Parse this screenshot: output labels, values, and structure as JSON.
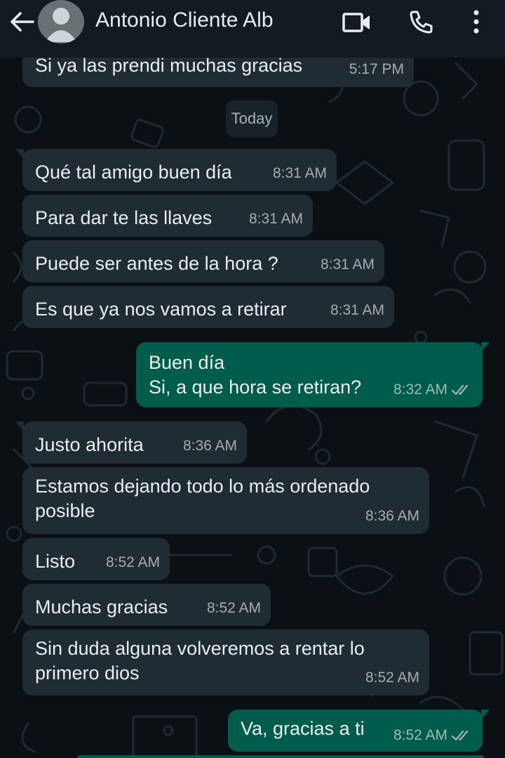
{
  "header": {
    "contact_name": "Antonio Cliente Alb",
    "icons": [
      "back-arrow-icon",
      "avatar",
      "video-call-icon",
      "phone-icon",
      "more-options-icon"
    ]
  },
  "date_separator": "Today",
  "messages": [
    {
      "direction": "in",
      "text": "Si ya las prendi muchas gracias",
      "time": "5:17 PM"
    },
    {
      "direction": "in",
      "text": "Qué tal amigo buen día",
      "time": "8:31 AM"
    },
    {
      "direction": "in",
      "text": "Para dar te las llaves",
      "time": "8:31 AM"
    },
    {
      "direction": "in",
      "text": "Puede ser antes de la hora ?",
      "time": "8:31 AM"
    },
    {
      "direction": "in",
      "text": "Es que ya nos vamos a retirar",
      "time": "8:31 AM"
    },
    {
      "direction": "out",
      "text": "Buen día\nSi, a que hora se retiran?",
      "time": "8:32 AM",
      "status": "read"
    },
    {
      "direction": "in",
      "text": "Justo ahorita",
      "time": "8:36 AM"
    },
    {
      "direction": "in",
      "text": "Estamos dejando todo lo más ordenado\nposible",
      "time": "8:36 AM"
    },
    {
      "direction": "in",
      "text": "Listo",
      "time": "8:52 AM"
    },
    {
      "direction": "in",
      "text": "Muchas gracias",
      "time": "8:52 AM"
    },
    {
      "direction": "in",
      "text": "Sin duda alguna volveremos a rentar lo\nprimero dios",
      "time": "8:52 AM"
    },
    {
      "direction": "out",
      "text": "Va, gracias a ti",
      "time": "8:52 AM",
      "status": "read"
    }
  ],
  "colors": {
    "background": "#0b1014",
    "header": "#111b21",
    "incoming_bubble": "#202c33",
    "outgoing_bubble": "#005c4b",
    "text": "#e9edef"
  }
}
